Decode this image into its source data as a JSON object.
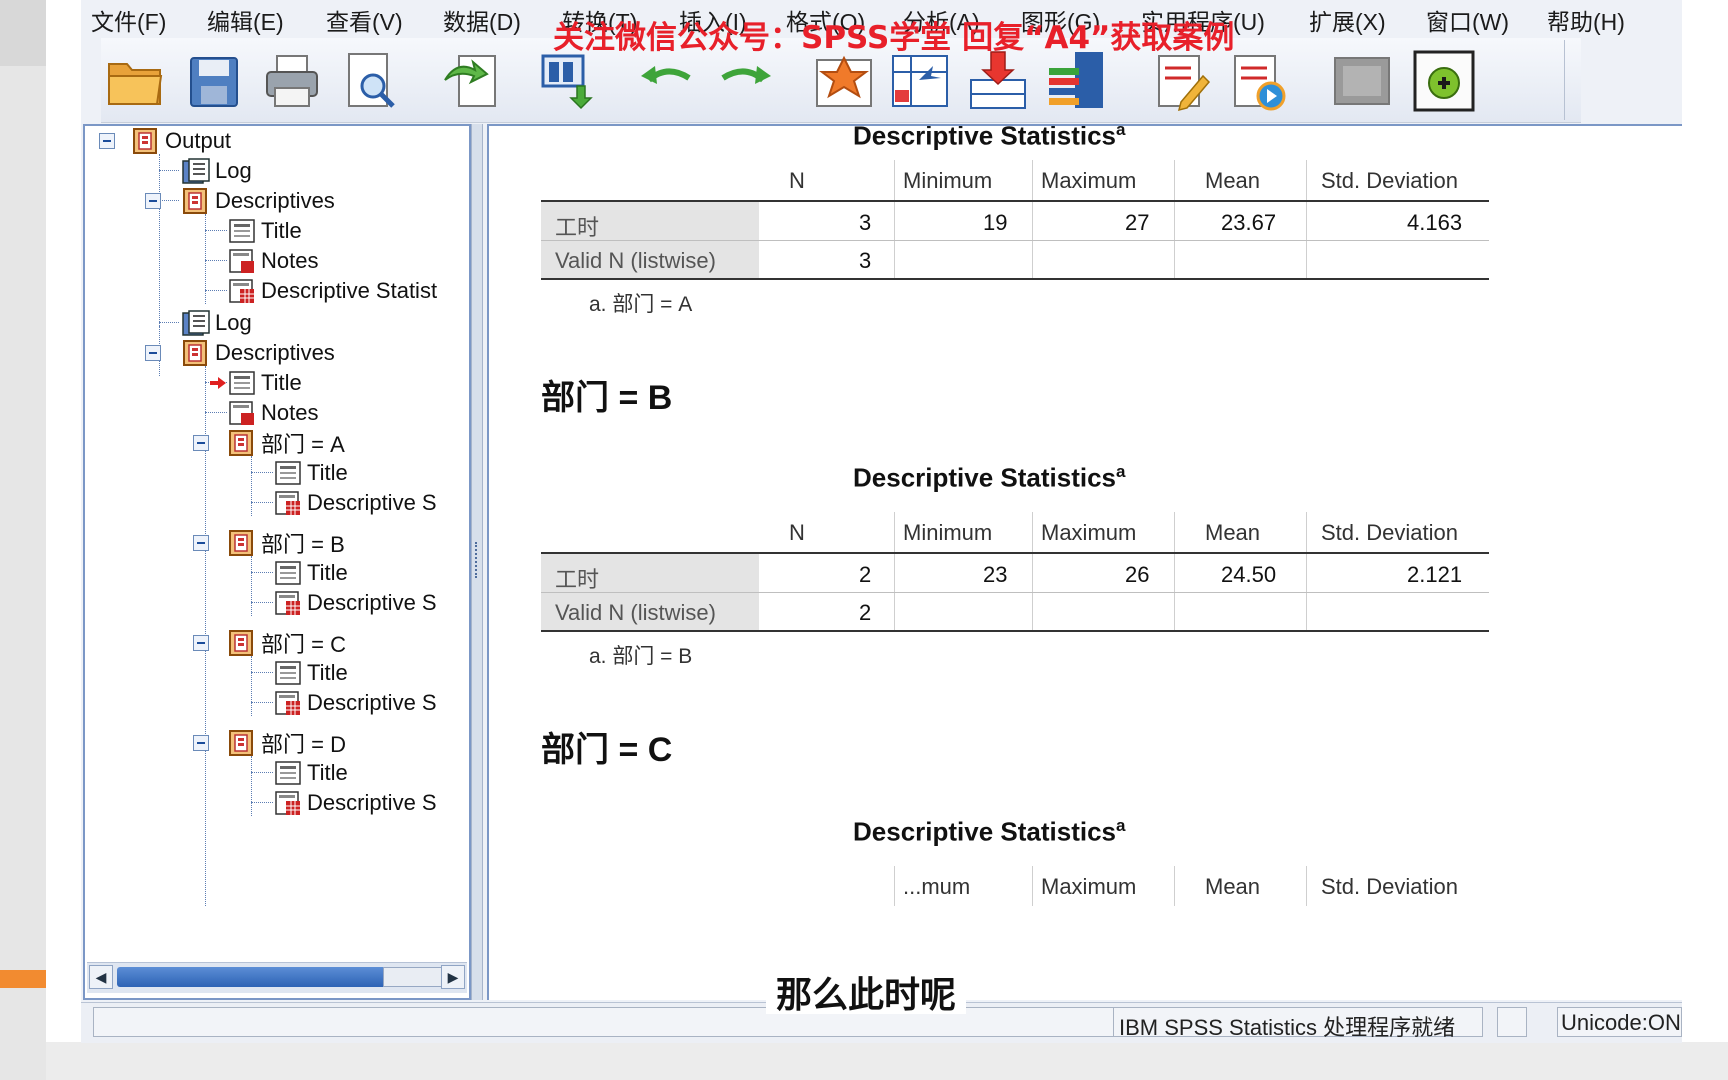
{
  "menubar": {
    "items": [
      "文件(F)",
      "编辑(E)",
      "查看(V)",
      "数据(D)",
      "转换(T)",
      "插入(I)",
      "格式(O)",
      "分析(A)",
      "图形(G)",
      "实用程序(U)",
      "扩展(X)",
      "窗口(W)",
      "帮助(H)"
    ]
  },
  "watermark": "关注微信公众号：SPSS学堂 回复“A4”获取案例",
  "toolbar": {
    "icons": [
      "open-folder-icon",
      "save-icon",
      "print-icon",
      "print-preview-icon",
      "export-icon",
      "recall-dialog-icon",
      "undo-icon",
      "redo-icon",
      "goto-data-icon",
      "goto-case-icon",
      "goto-variable-icon",
      "variables-icon",
      "designate-window-icon",
      "run-script-icon",
      "disabled-icon",
      "add-icon"
    ]
  },
  "tree": {
    "items": [
      {
        "label": "Output",
        "icon": "output-icon"
      },
      {
        "label": "Log",
        "icon": "log-icon"
      },
      {
        "label": "Descriptives",
        "icon": "procedure-icon"
      },
      {
        "label": "Title",
        "icon": "title-icon"
      },
      {
        "label": "Notes",
        "icon": "notes-icon"
      },
      {
        "label": "Descriptive Statist",
        "icon": "table-icon"
      },
      {
        "label": "Log",
        "icon": "log-icon"
      },
      {
        "label": "Descriptives",
        "icon": "procedure-icon"
      },
      {
        "label": "Title",
        "icon": "title-icon"
      },
      {
        "label": "Notes",
        "icon": "notes-icon"
      },
      {
        "label": "部门 = A",
        "icon": "procedure-icon"
      },
      {
        "label": "Title",
        "icon": "title-icon"
      },
      {
        "label": "Descriptive S",
        "icon": "table-icon"
      },
      {
        "label": "部门 = B",
        "icon": "procedure-icon"
      },
      {
        "label": "Title",
        "icon": "title-icon"
      },
      {
        "label": "Descriptive S",
        "icon": "table-icon"
      },
      {
        "label": "部门 = C",
        "icon": "procedure-icon"
      },
      {
        "label": "Title",
        "icon": "title-icon"
      },
      {
        "label": "Descriptive S",
        "icon": "table-icon"
      },
      {
        "label": "部门 = D",
        "icon": "procedure-icon"
      },
      {
        "label": "Title",
        "icon": "title-icon"
      },
      {
        "label": "Descriptive S",
        "icon": "table-icon"
      }
    ]
  },
  "content": {
    "table_title": "Descriptive Statistics",
    "superscript": "a",
    "columns": [
      "N",
      "Minimum",
      "Maximum",
      "Mean",
      "Std. Deviation"
    ],
    "tables": [
      {
        "row": {
          "label": "工时",
          "n": "3",
          "min": "19",
          "max": "27",
          "mean": "23.67",
          "sd": "4.163"
        },
        "valid": {
          "label": "Valid N (listwise)",
          "n": "3"
        },
        "footnote": "a. 部门 = A"
      },
      {
        "row": {
          "label": "工时",
          "n": "2",
          "min": "23",
          "max": "26",
          "mean": "24.50",
          "sd": "2.121"
        },
        "valid": {
          "label": "Valid N (listwise)",
          "n": "2"
        },
        "footnote": "a. 部门 = B"
      }
    ],
    "section_b": "部门 = B",
    "section_c": "部门 = C",
    "partial_columns": [
      "...mum",
      "Maximum",
      "Mean",
      "Std. Deviation"
    ]
  },
  "subtitle": "那么此时呢",
  "status": {
    "processor": "IBM SPSS Statistics 处理程序就绪",
    "unicode": "Unicode:ON"
  }
}
